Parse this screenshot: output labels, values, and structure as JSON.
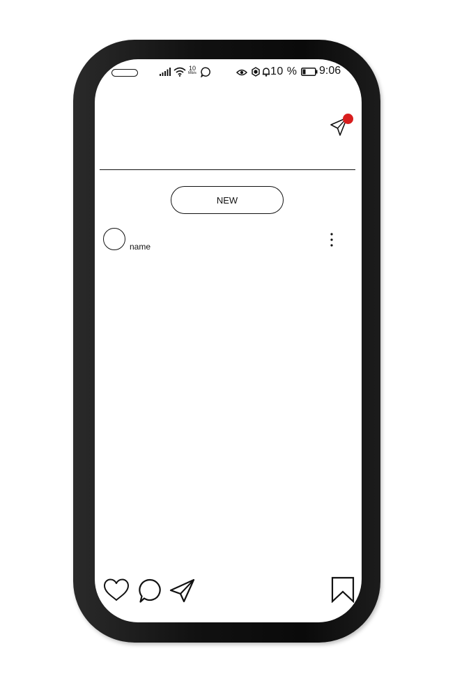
{
  "status_bar": {
    "network_speed_value": "10",
    "network_speed_unit": "Mb/s",
    "battery_percent": "10 %",
    "time": "9:06"
  },
  "feed": {
    "new_button_label": "NEW"
  },
  "post": {
    "username": "name"
  },
  "colors": {
    "notification_dot": "#d81e1e",
    "phone_frame": "#111111",
    "screen": "#ffffff"
  },
  "icons": {
    "header": [
      "paper-plane-icon"
    ],
    "status": [
      "signal-icon",
      "wifi-icon",
      "chat-bubble-icon",
      "eye-icon",
      "shield-icon",
      "bell-icon",
      "battery-icon"
    ],
    "actions": [
      "heart-icon",
      "comment-icon",
      "share-icon",
      "bookmark-icon"
    ]
  }
}
